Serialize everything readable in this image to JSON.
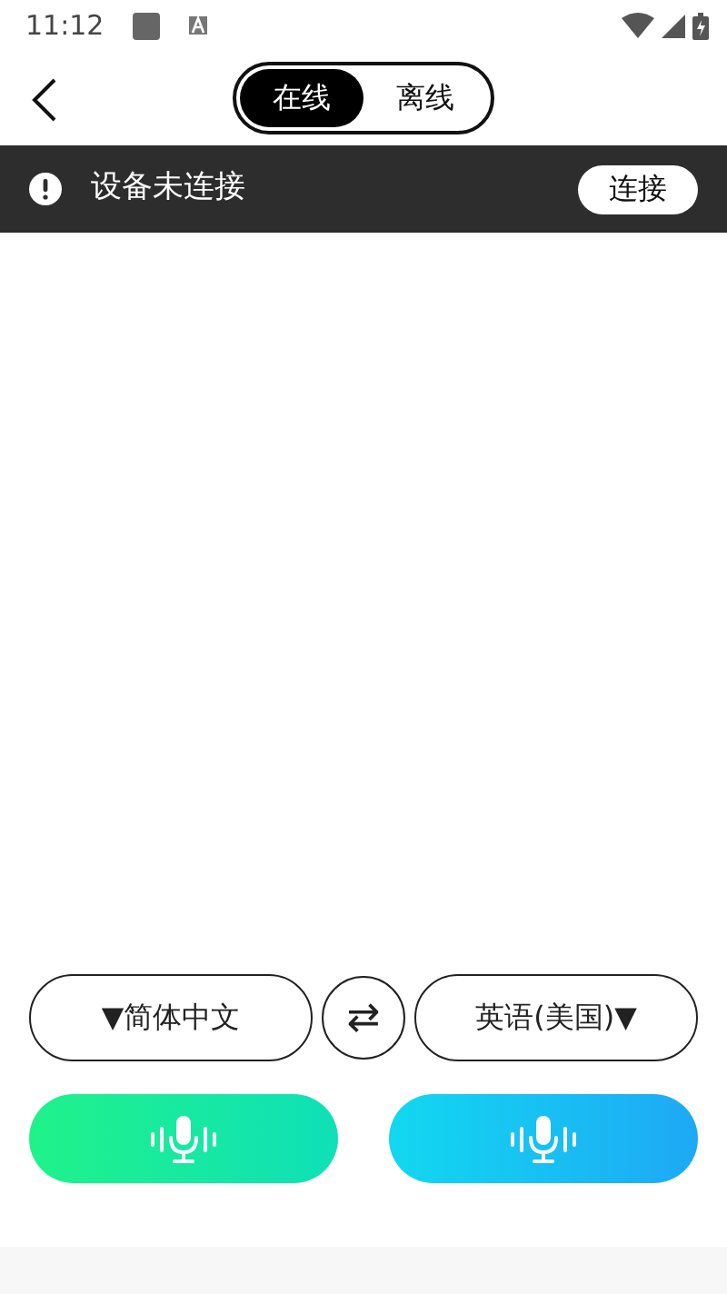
{
  "status_bar": {
    "time": "11:12"
  },
  "mode_tabs": [
    {
      "label": "在线",
      "selected": true
    },
    {
      "label": "离线",
      "selected": false
    }
  ],
  "banner": {
    "message": "设备未连接",
    "button": "连接"
  },
  "languages": {
    "source": "▼简体中文",
    "swap": "⇄",
    "target": "英语(美国)▼"
  },
  "mic_buttons": [
    {
      "kind": "source",
      "color": "#20f28a"
    },
    {
      "kind": "target",
      "color": "#1ea8f5"
    }
  ]
}
